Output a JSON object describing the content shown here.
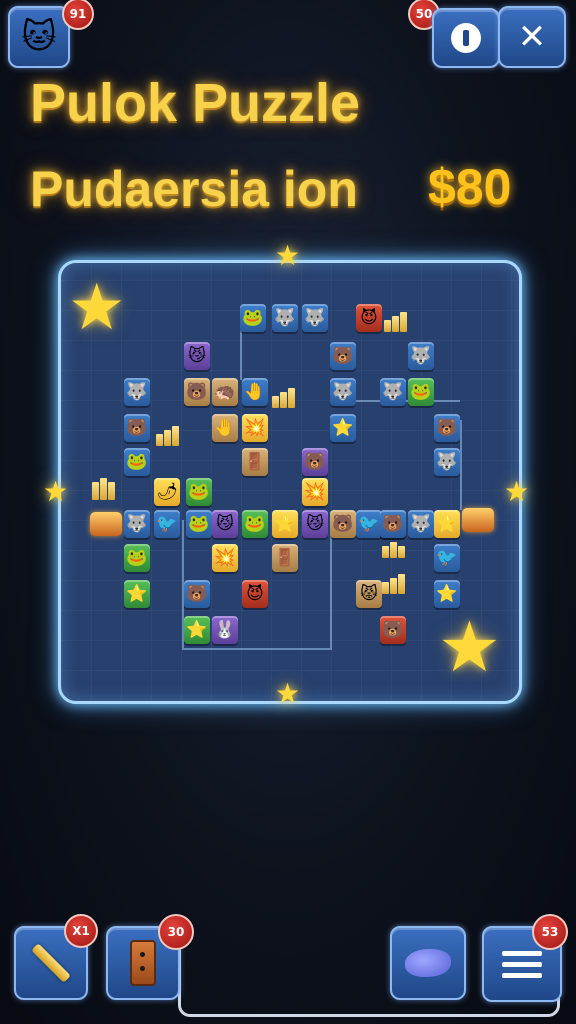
{
  "title": {
    "line1": "Pulok Puzzle",
    "line2": "Pudaersia ion",
    "price": "$80"
  },
  "top_left": {
    "badge": "91",
    "icon": "cat-icon"
  },
  "top_right": {
    "badge": "50",
    "info_icon": "info-icon",
    "tools_icon": "crossed-tools-icon"
  },
  "bottom": {
    "hammer": {
      "badge": "X1",
      "icon": "hammer-icon"
    },
    "door": {
      "badge": "30",
      "icon": "door-icon"
    },
    "fish": {
      "icon": "fish-icon"
    },
    "menu": {
      "badge": "53",
      "icon": "menu-icon"
    }
  },
  "board": {
    "tiles": [
      {
        "c": "blue",
        "g": "🐸"
      },
      {
        "c": "blue",
        "g": "🐺"
      },
      {
        "c": "blue",
        "g": "🐺"
      },
      {
        "c": "red",
        "g": "😈"
      },
      {
        "c": "purple",
        "g": "😼"
      },
      {
        "c": "blue",
        "g": "🐻"
      },
      {
        "c": "blue",
        "g": "🐺"
      },
      {
        "c": "blue",
        "g": "🐺"
      },
      {
        "c": "tan",
        "g": "🐻"
      },
      {
        "c": "tan",
        "g": "🦔"
      },
      {
        "c": "blue",
        "g": "🤚"
      },
      {
        "c": "blue",
        "g": "🐺"
      },
      {
        "c": "blue",
        "g": "🐺"
      },
      {
        "c": "green",
        "g": "🐸"
      },
      {
        "c": "blue",
        "g": "🐻"
      },
      {
        "c": "tan",
        "g": "🤚"
      },
      {
        "c": "yellow",
        "g": "💥"
      },
      {
        "c": "blue",
        "g": "⭐"
      },
      {
        "c": "blue",
        "g": "🐻"
      },
      {
        "c": "blue",
        "g": "🐸"
      },
      {
        "c": "tan",
        "g": "🚪"
      },
      {
        "c": "purple",
        "g": "🐻"
      },
      {
        "c": "blue",
        "g": "🐺"
      },
      {
        "c": "yellow",
        "g": "🌶"
      },
      {
        "c": "green",
        "g": "🐸"
      },
      {
        "c": "blue",
        "g": "🐦"
      },
      {
        "c": "purple",
        "g": "😼"
      },
      {
        "c": "green",
        "g": "🐸"
      },
      {
        "c": "yellow",
        "g": "⭐"
      },
      {
        "c": "purple",
        "g": "😼"
      },
      {
        "c": "tan",
        "g": "🐻"
      },
      {
        "c": "blue",
        "g": "🐦"
      },
      {
        "c": "purple",
        "g": "😺"
      },
      {
        "c": "blue",
        "g": "🐺"
      },
      {
        "c": "yellow",
        "g": "⭐"
      },
      {
        "c": "green",
        "g": "🐸"
      },
      {
        "c": "yellow",
        "g": "💥"
      },
      {
        "c": "tan",
        "g": "🚪"
      },
      {
        "c": "blue",
        "g": "🐦"
      },
      {
        "c": "green",
        "g": "⭐"
      },
      {
        "c": "blue",
        "g": "🐻"
      },
      {
        "c": "red",
        "g": "😈"
      },
      {
        "c": "tan",
        "g": "😾"
      },
      {
        "c": "blue",
        "g": "⭐"
      },
      {
        "c": "green",
        "g": "⭐"
      },
      {
        "c": "purple",
        "g": "🐰"
      },
      {
        "c": "red",
        "g": "🐻"
      },
      {
        "c": "blue",
        "g": "🐻"
      },
      {
        "c": "blue",
        "g": "🐺"
      },
      {
        "c": "blue",
        "g": "🐸"
      },
      {
        "c": "yellow",
        "g": "💥"
      }
    ]
  },
  "colors": {
    "accent_gold": "#f7d24a",
    "board_glow": "#a9d8ff",
    "button_blue": "#2f5fa8",
    "badge_red": "#c8261e"
  }
}
